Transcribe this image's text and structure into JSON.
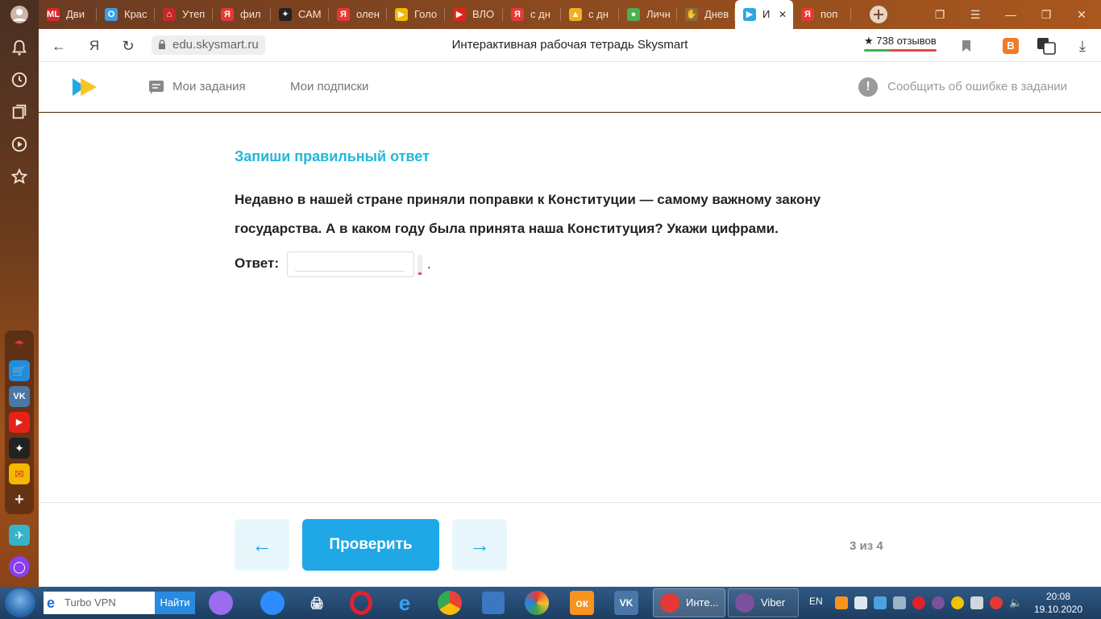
{
  "browser": {
    "tabs": [
      {
        "label": "Дви",
        "fav_text": "ML",
        "fav_color": "#d9262c"
      },
      {
        "label": "Крас",
        "fav_text": "О",
        "fav_color": "#3aa0e6"
      },
      {
        "label": "Утеп",
        "fav_text": "⌂",
        "fav_color": "#c62828"
      },
      {
        "label": "фил",
        "fav_text": "Я",
        "fav_color": "#e53935"
      },
      {
        "label": "САМ",
        "fav_text": "✦",
        "fav_color": "#222222"
      },
      {
        "label": "олен",
        "fav_text": "Я",
        "fav_color": "#e53935"
      },
      {
        "label": "Голо",
        "fav_text": "▶",
        "fav_color": "#f5b800"
      },
      {
        "label": "ВЛО",
        "fav_text": "▶",
        "fav_color": "#e62117"
      },
      {
        "label": "с дн",
        "fav_text": "Я",
        "fav_color": "#e53935"
      },
      {
        "label": "с дн",
        "fav_text": "▲",
        "fav_color": "#f2b01e"
      },
      {
        "label": "Личн",
        "fav_text": "●",
        "fav_color": "#4caf50"
      },
      {
        "label": "Днев",
        "fav_text": "✋",
        "fav_color": "#8e6b3a"
      },
      {
        "label": "И",
        "fav_text": "▶",
        "fav_color": "#2aa8e0",
        "active": true
      },
      {
        "label": "поп",
        "fav_text": "Я",
        "fav_color": "#e53935"
      }
    ],
    "url": "edu.skysmart.ru",
    "page_title": "Интерактивная рабочая тетрадь Skysmart",
    "reviews": "★ 738 отзывов",
    "yandex_letter": "Я"
  },
  "site": {
    "nav": {
      "my_tasks": "Мои задания",
      "my_subscriptions": "Мои подписки",
      "report_error": "Сообщить об ошибке в задании"
    }
  },
  "task": {
    "heading": "Запиши правильный ответ",
    "question": "Недавно в нашей стране приняли поправки к Конституции — самому важному закону государства. А в каком году была принята наша Конституция? Укажи цифрами.",
    "answer_label": "Ответ:",
    "answer_value": "",
    "period": "."
  },
  "footer": {
    "prev_arrow": "←",
    "next_arrow": "→",
    "check_label": "Проверить",
    "progress": "3 из 4"
  },
  "taskbar": {
    "search_placeholder": "Turbo VPN",
    "search_button": "Найти",
    "task_browser": "Инте...",
    "task_viber": "Viber",
    "lang": "EN",
    "time": "20:08",
    "date": "19.10.2020"
  },
  "colors": {
    "accent_blue": "#1fa7e6",
    "heading_cyan": "#21b8d9"
  }
}
